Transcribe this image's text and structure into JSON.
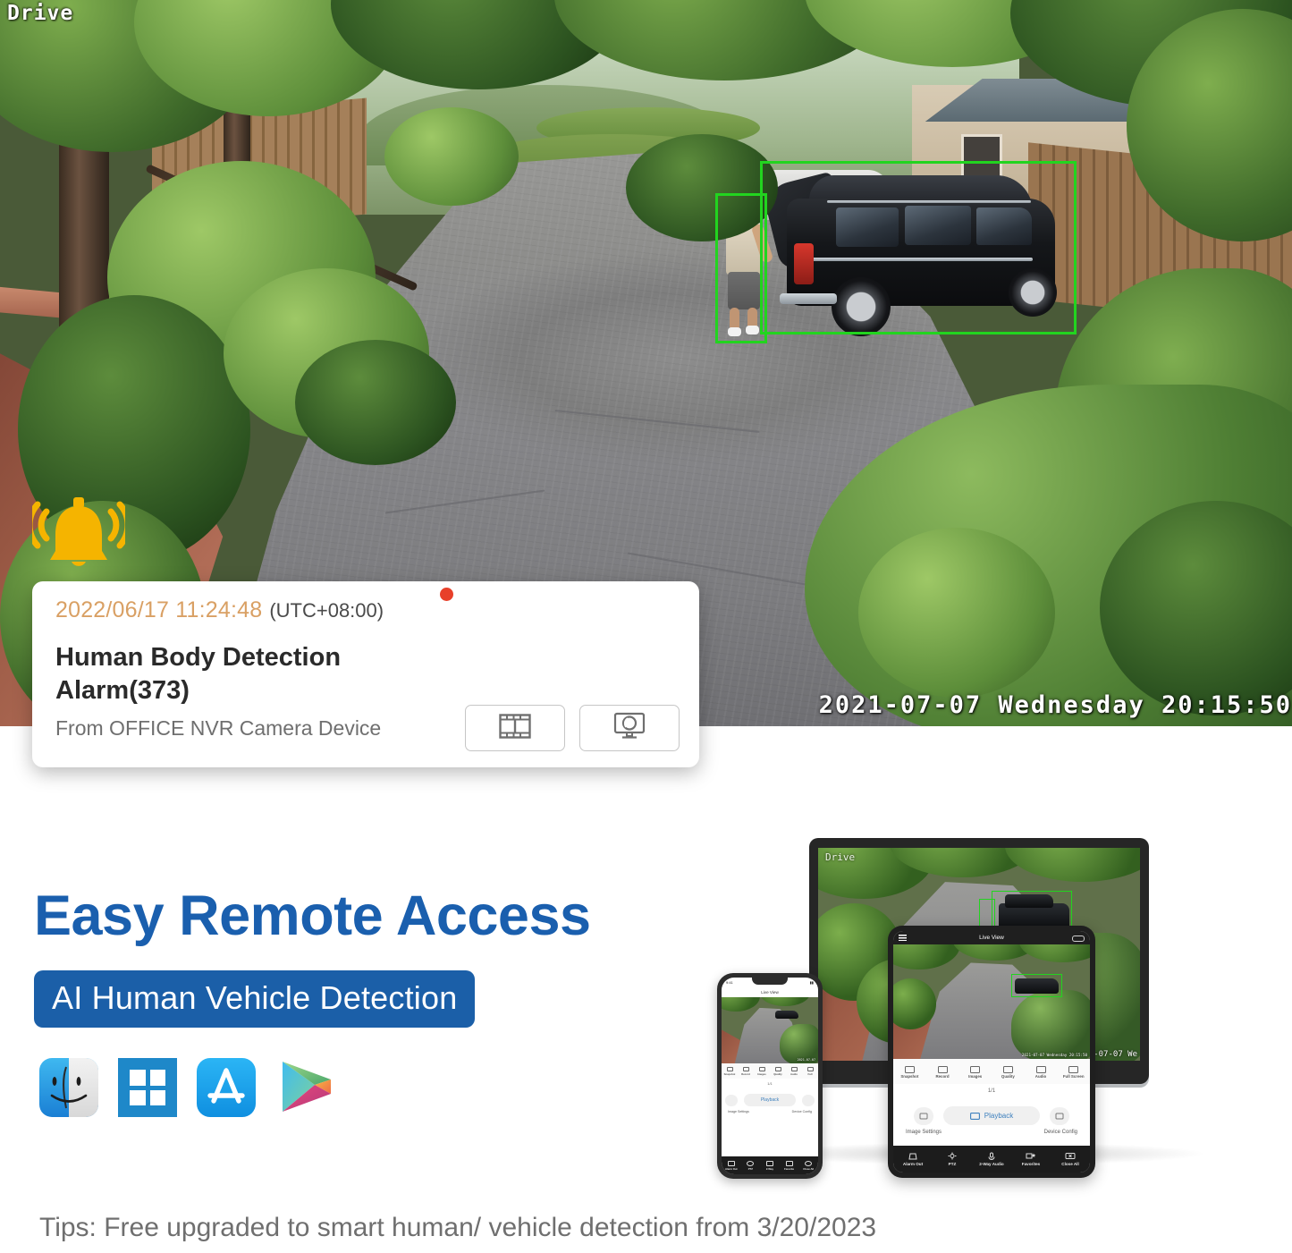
{
  "camera_feed": {
    "channel_label": "Drive",
    "timestamp_overlay": "2021-07-07 Wednesday 20:15:50",
    "detection_boxes": [
      {
        "name": "person-box",
        "color": "#22d41f"
      },
      {
        "name": "vehicle-box",
        "color": "#22d41f"
      }
    ],
    "bell_icon_color": "#F5B400"
  },
  "alarm_card": {
    "date_time": "2022/06/17 11:24:48",
    "timezone": "(UTC+08:00)",
    "date_color": "#d9a064",
    "title": "Human Body Detection Alarm(373)",
    "source": "From OFFICE NVR Camera Device",
    "unread_dot_color": "#e8402a",
    "actions": [
      {
        "name": "video-clip-button",
        "icon": "film-strip-icon"
      },
      {
        "name": "live-view-button",
        "icon": "monitor-camera-icon"
      }
    ]
  },
  "marketing": {
    "headline": "Easy Remote Access",
    "headline_color": "#1a5fae",
    "badge": "AI Human Vehicle Detection",
    "badge_bg": "#1b5fa8",
    "platform_icons": [
      {
        "name": "macos-finder-icon",
        "label": "macOS"
      },
      {
        "name": "windows-icon",
        "label": "Windows"
      },
      {
        "name": "app-store-icon",
        "label": "App Store"
      },
      {
        "name": "google-play-icon",
        "label": "Google Play"
      }
    ],
    "tip": "Tips: Free upgraded to smart human/ vehicle detection from 3/20/2023"
  },
  "devices": {
    "monitor": {
      "channel_label": "Drive",
      "timestamp": "2021-07-07 We"
    },
    "tablet": {
      "title": "Live View",
      "page_indicator": "1/1",
      "toolbar": [
        {
          "label": "Snapshot",
          "icon": "snapshot-icon"
        },
        {
          "label": "Record",
          "icon": "record-icon"
        },
        {
          "label": "Images",
          "icon": "images-icon"
        },
        {
          "label": "Quality",
          "icon": "quality-icon"
        },
        {
          "label": "Audio",
          "icon": "audio-icon"
        },
        {
          "label": "Full Screen",
          "icon": "fullscreen-icon"
        }
      ],
      "playback_label": "Playback",
      "image_settings_label": "Image Settings",
      "device_config_label": "Device Config",
      "bottom_nav": [
        {
          "label": "Alarm Out",
          "icon": "alarm-out-icon"
        },
        {
          "label": "PTZ",
          "icon": "ptz-icon"
        },
        {
          "label": "2-Way Audio",
          "icon": "two-way-audio-icon"
        },
        {
          "label": "Favorites",
          "icon": "favorites-icon"
        },
        {
          "label": "Close All",
          "icon": "close-all-icon"
        }
      ]
    },
    "phone": {
      "title": "Live View",
      "page_indicator": "1/1",
      "toolbar": [
        {
          "label": "Snapshot"
        },
        {
          "label": "Record"
        },
        {
          "label": "Images"
        },
        {
          "label": "Quality"
        },
        {
          "label": "Audio"
        },
        {
          "label": "Full"
        }
      ],
      "playback_label": "Playback",
      "image_settings_label": "Image Settings",
      "device_config_label": "Device Config",
      "bottom_nav": [
        {
          "label": "Alarm Out"
        },
        {
          "label": "PTZ"
        },
        {
          "label": "2-Way"
        },
        {
          "label": "Favorite"
        },
        {
          "label": "Close All"
        }
      ]
    }
  }
}
